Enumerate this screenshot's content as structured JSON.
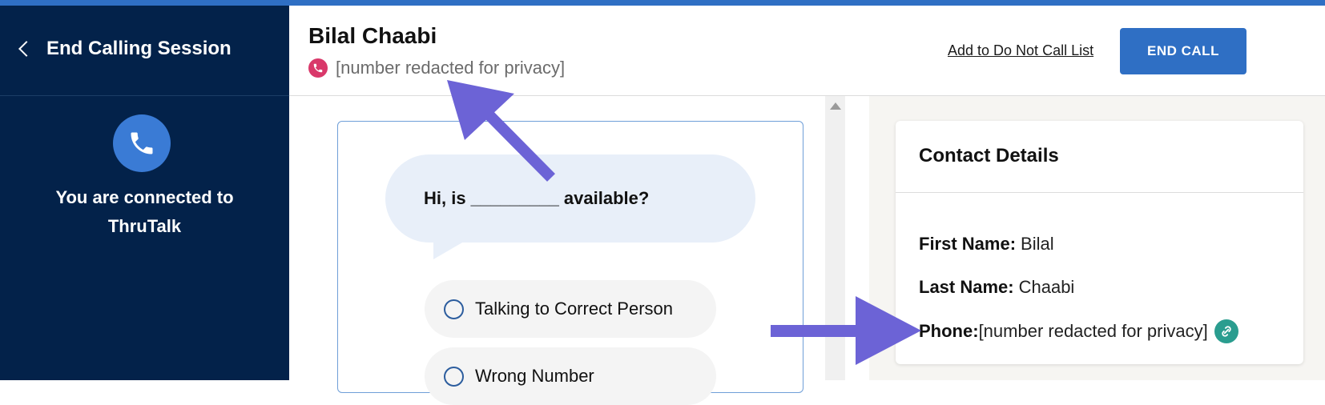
{
  "sidebar": {
    "back_label": "End Calling Session",
    "status_line1": "You are connected to",
    "status_line2": "ThruTalk"
  },
  "header": {
    "contact_name": "Bilal Chaabi",
    "phone_number": "[number redacted for privacy]",
    "dnc_link": "Add to Do Not Call List",
    "end_call_label": "END CALL"
  },
  "script": {
    "question": "Hi, is _________ available?",
    "options": [
      {
        "label": "Talking to Correct Person"
      },
      {
        "label": "Wrong Number"
      }
    ]
  },
  "contact_details": {
    "title": "Contact Details",
    "first_name_label": "First Name:",
    "first_name_value": "Bilal",
    "last_name_label": "Last Name:",
    "last_name_value": "Chaabi",
    "phone_label": "Phone:",
    "phone_value": "[number redacted for privacy]"
  },
  "colors": {
    "sidebar_bg": "#03224a",
    "accent": "#2f6fc4",
    "annotation_arrow": "#6c63d6"
  }
}
